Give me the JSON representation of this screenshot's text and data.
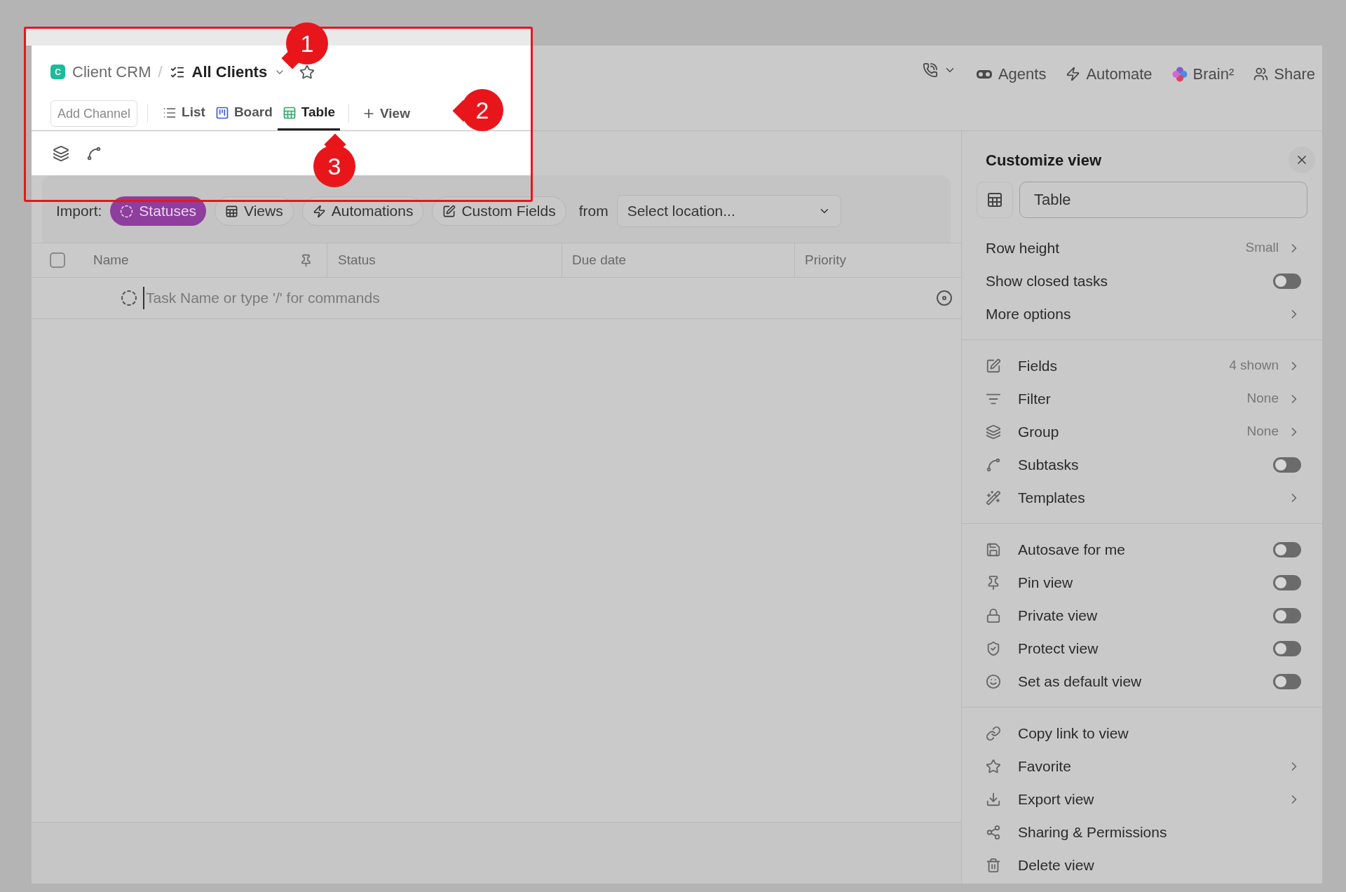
{
  "breadcrumb": {
    "badge": "C",
    "space": "Client CRM",
    "separator": "/",
    "list": "All Clients"
  },
  "toolbar": {
    "add_channel": "Add Channel",
    "tabs": [
      {
        "label": "List",
        "selected": false,
        "color": "#6b6b6b"
      },
      {
        "label": "Board",
        "selected": false,
        "color": "#3b5bdb"
      },
      {
        "label": "Table",
        "selected": true,
        "color": "#2da86a"
      }
    ],
    "add_view": "View"
  },
  "top_actions": [
    "Agents",
    "Automate",
    "Brain²",
    "Share"
  ],
  "import_bar": {
    "label": "Import:",
    "chips": [
      {
        "label": "Statuses",
        "selected": true
      },
      {
        "label": "Views",
        "selected": false
      },
      {
        "label": "Automations",
        "selected": false
      },
      {
        "label": "Custom Fields",
        "selected": false
      }
    ],
    "from": "from",
    "location": "Select location..."
  },
  "table": {
    "select_all_checked": false,
    "columns": [
      "Name",
      "Status",
      "Due date",
      "Priority"
    ],
    "new_task_placeholder": "Task Name or type '/' for commands"
  },
  "panel": {
    "title": "Customize view",
    "view_name": "Table",
    "sections": [
      [
        {
          "kind": "value",
          "label": "Row height",
          "value": "Small"
        },
        {
          "kind": "toggle",
          "label": "Show closed tasks",
          "on": false
        },
        {
          "kind": "link",
          "label": "More options"
        }
      ],
      [
        {
          "kind": "value",
          "label": "Fields",
          "value": "4 shown"
        },
        {
          "kind": "value",
          "label": "Filter",
          "value": "None"
        },
        {
          "kind": "value",
          "label": "Group",
          "value": "None"
        },
        {
          "kind": "toggle",
          "label": "Subtasks",
          "on": false
        },
        {
          "kind": "link",
          "label": "Templates"
        }
      ],
      [
        {
          "kind": "toggle",
          "label": "Autosave for me",
          "on": false
        },
        {
          "kind": "toggle",
          "label": "Pin view",
          "on": false
        },
        {
          "kind": "toggle",
          "label": "Private view",
          "on": false
        },
        {
          "kind": "toggle",
          "label": "Protect view",
          "on": false
        },
        {
          "kind": "toggle",
          "label": "Set as default view",
          "on": false
        }
      ],
      [
        {
          "kind": "action",
          "label": "Copy link to view"
        },
        {
          "kind": "link",
          "label": "Favorite"
        },
        {
          "kind": "link",
          "label": "Export view"
        },
        {
          "kind": "action",
          "label": "Sharing & Permissions"
        },
        {
          "kind": "action",
          "label": "Delete view"
        }
      ]
    ]
  },
  "annotations": [
    "1",
    "2",
    "3"
  ]
}
